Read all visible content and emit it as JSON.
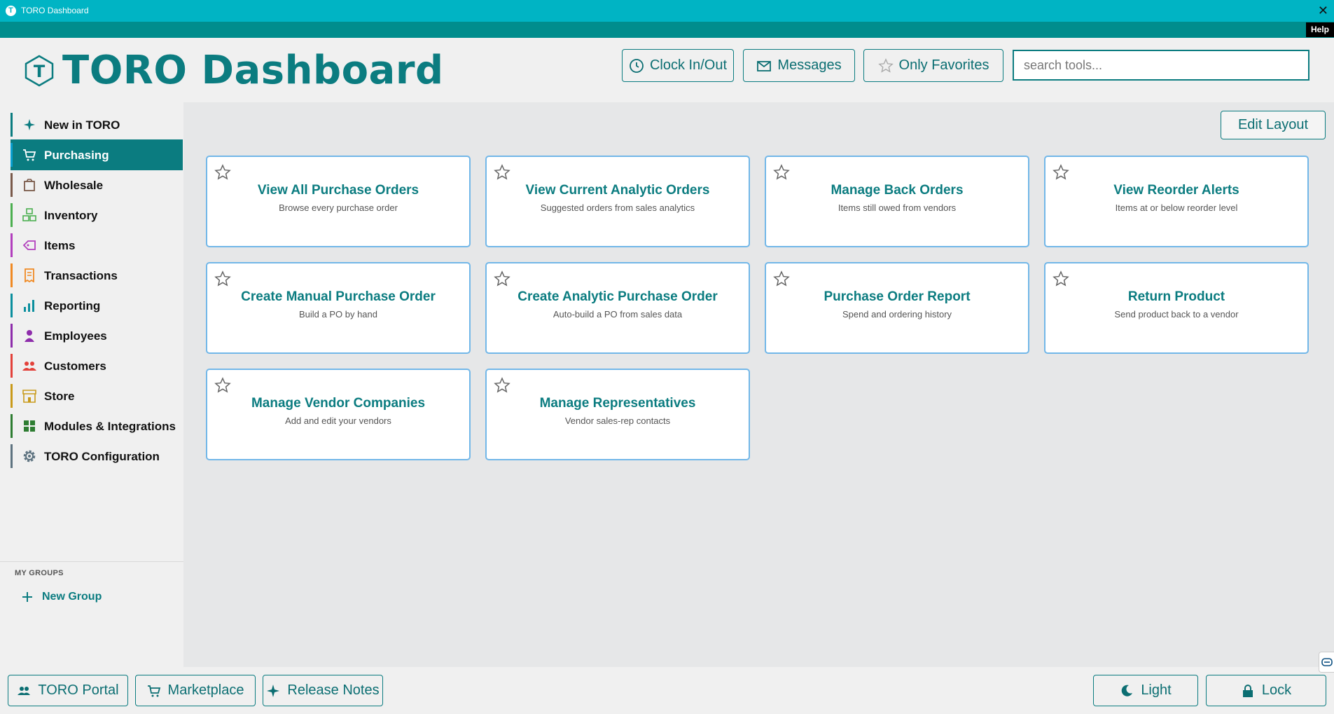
{
  "window": {
    "title": "TORO Dashboard",
    "close_glyph": "✕"
  },
  "helpbar": {
    "help_label": "Help"
  },
  "header": {
    "logo_letter": "T",
    "title": "TORO Dashboard",
    "clock_label": "Clock In/Out",
    "messages_label": "Messages",
    "favorites_label": "Only Favorites",
    "search_placeholder": "search tools..."
  },
  "sidebar": {
    "items": [
      {
        "label": "New in TORO",
        "icon": "sparkle-icon",
        "color": "#0b7c80"
      },
      {
        "label": "Purchasing",
        "icon": "cart-icon",
        "color": "#0b7c80",
        "active": true
      },
      {
        "label": "Wholesale",
        "icon": "box-icon",
        "color": "#7a5a4a"
      },
      {
        "label": "Inventory",
        "icon": "boxes-icon",
        "color": "#4caf50"
      },
      {
        "label": "Items",
        "icon": "tag-icon",
        "color": "#b23fbd"
      },
      {
        "label": "Transactions",
        "icon": "receipt-icon",
        "color": "#f08a24"
      },
      {
        "label": "Reporting",
        "icon": "bar-chart-icon",
        "color": "#0b8f9e"
      },
      {
        "label": "Employees",
        "icon": "person-icon",
        "color": "#8e2dab"
      },
      {
        "label": "Customers",
        "icon": "people-icon",
        "color": "#e3413a"
      },
      {
        "label": "Store",
        "icon": "store-icon",
        "color": "#c99a1a"
      },
      {
        "label": "Modules & Integrations",
        "icon": "grid-icon",
        "color": "#2e7d32"
      },
      {
        "label": "TORO Configuration",
        "icon": "gear-icon",
        "color": "#5e7380"
      }
    ],
    "groups_label": "MY GROUPS",
    "new_group_label": "New Group"
  },
  "main": {
    "edit_layout_label": "Edit Layout",
    "cards": [
      {
        "title": "View All Purchase Orders",
        "subtitle": "Browse every purchase order"
      },
      {
        "title": "View Current Analytic Orders",
        "subtitle": "Suggested orders from sales analytics"
      },
      {
        "title": "Manage Back Orders",
        "subtitle": "Items still owed from vendors"
      },
      {
        "title": "View Reorder Alerts",
        "subtitle": "Items at or below reorder level"
      },
      {
        "title": "Create Manual Purchase Order",
        "subtitle": "Build a PO by hand"
      },
      {
        "title": "Create Analytic Purchase Order",
        "subtitle": "Auto-build a PO from sales data"
      },
      {
        "title": "Purchase Order Report",
        "subtitle": "Spend and ordering history"
      },
      {
        "title": "Return Product",
        "subtitle": "Send product back to a vendor"
      },
      {
        "title": "Manage Vendor Companies",
        "subtitle": "Add and edit your vendors"
      },
      {
        "title": "Manage Representatives",
        "subtitle": "Vendor sales-rep contacts"
      }
    ]
  },
  "footer": {
    "portal_label": "TORO Portal",
    "marketplace_label": "Marketplace",
    "release_notes_label": "Release Notes",
    "theme_label": "Light",
    "lock_label": "Lock"
  },
  "colors": {
    "accent": "#0b7c80",
    "titlebar": "#00b4c4",
    "helpbar": "#008d8d",
    "card_border": "#72b7e8"
  }
}
